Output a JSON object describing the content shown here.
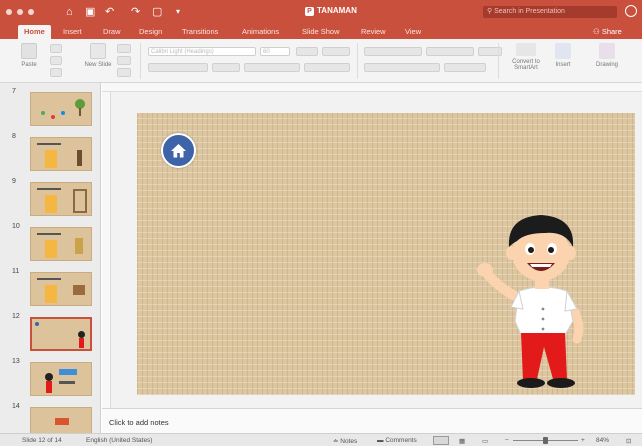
{
  "window": {
    "title": "TANAMAN",
    "search_placeholder": "Search in Presentation",
    "share_label": "Share"
  },
  "ribbon_tabs": [
    "Home",
    "Insert",
    "Draw",
    "Design",
    "Transitions",
    "Animations",
    "Slide Show",
    "Review",
    "View"
  ],
  "ribbon": {
    "paste_label": "Paste",
    "new_slide_label": "New Slide",
    "font_name": "Calibri Light (Headings)",
    "font_size": "60",
    "convert_label": "Convert to SmartArt",
    "insert_label": "Insert",
    "drawing_label": "Drawing"
  },
  "slides": [
    {
      "num": "7"
    },
    {
      "num": "8"
    },
    {
      "num": "9"
    },
    {
      "num": "10"
    },
    {
      "num": "11"
    },
    {
      "num": "12"
    },
    {
      "num": "13"
    },
    {
      "num": "14"
    }
  ],
  "notes_placeholder": "Click to add notes",
  "status": {
    "slide_info": "Slide 12 of 14",
    "language": "English (United States)",
    "notes_label": "Notes",
    "comments_label": "Comments",
    "zoom": "84%"
  },
  "colors": {
    "accent": "#c9503d",
    "slide_background": "#dcc6a0",
    "home_button": "#3f63a8"
  }
}
